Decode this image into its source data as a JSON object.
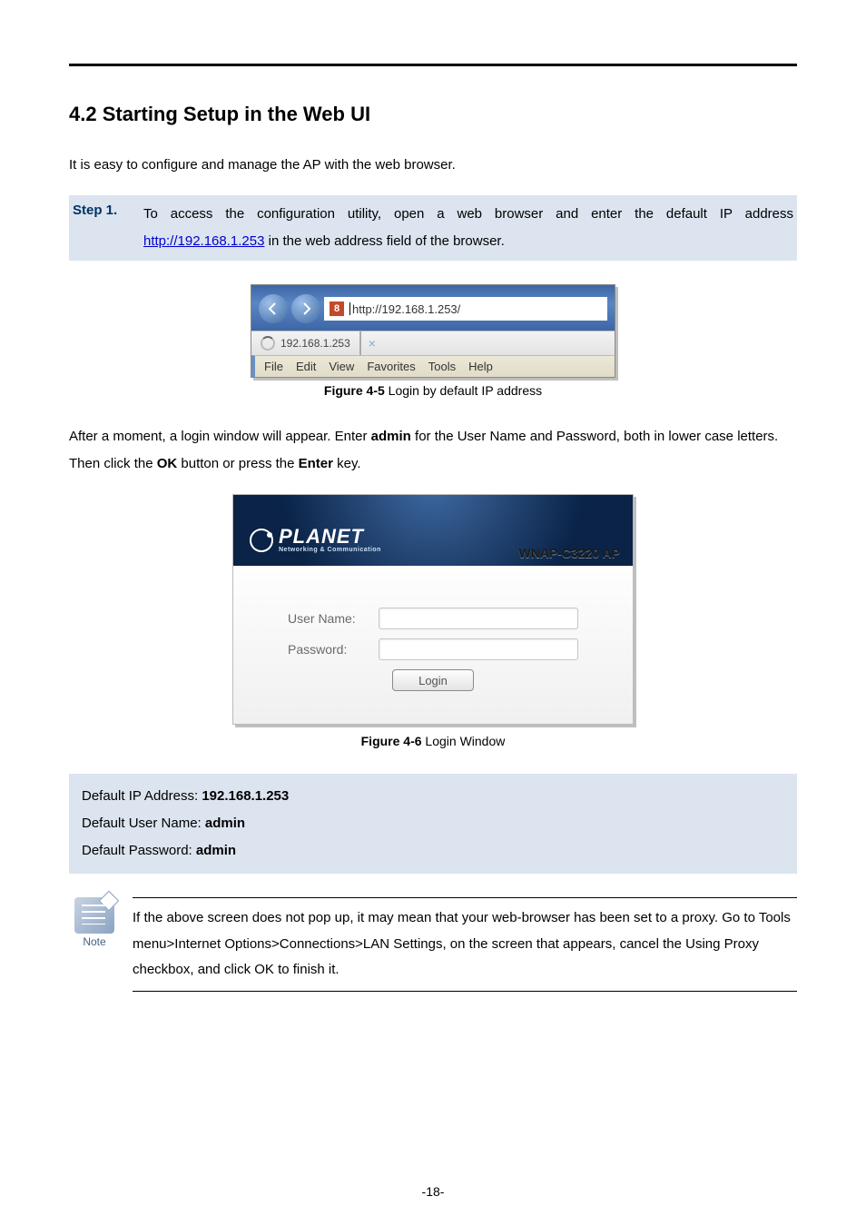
{
  "heading": "4.2  Starting Setup in the Web UI",
  "intro": "It is easy to configure and manage the AP with the web browser.",
  "step": {
    "label": "Step 1.",
    "text_before_link": "To access the configuration utility, open a web browser and enter the default IP address ",
    "link": "http://192.168.1.253",
    "text_after_link": " in the web address field of the browser."
  },
  "fig1": {
    "url_text": "http://192.168.1.253/",
    "favicon_char": "8",
    "tab_title": "192.168.1.253",
    "close_char": "×",
    "menu": [
      "File",
      "Edit",
      "View",
      "Favorites",
      "Tools",
      "Help"
    ],
    "caption_bold": "Figure 4-5",
    "caption_rest": " Login by default IP address"
  },
  "after_fig1_a": "After a moment, a login window will appear. Enter ",
  "after_fig1_admin": "admin",
  "after_fig1_b": " for the User Name and Password, both in lower case letters. Then click the ",
  "after_fig1_ok": "OK",
  "after_fig1_c": " button or press the ",
  "after_fig1_enter": "Enter",
  "after_fig1_d": " key.",
  "fig2": {
    "logo_big": "PLANET",
    "logo_small": "Networking & Communication",
    "model": "WNAP-C3220 AP",
    "username_label": "User Name:",
    "password_label": "Password:",
    "login_button": "Login",
    "caption_bold": "Figure 4-6",
    "caption_rest": " Login Window"
  },
  "defaults": {
    "ip_label": "Default IP Address: ",
    "ip_value": "192.168.1.253",
    "user_label": "Default User Name: ",
    "user_value": "admin",
    "pw_label": "Default Password: ",
    "pw_value": "admin"
  },
  "note": {
    "icon_label": "Note",
    "text": "If the above screen does not pop up, it may mean that your web-browser has been set to a proxy. Go to Tools menu>Internet Options>Connections>LAN Settings, on the screen that appears, cancel the Using Proxy checkbox, and click OK to finish it."
  },
  "page_number": "-18-"
}
